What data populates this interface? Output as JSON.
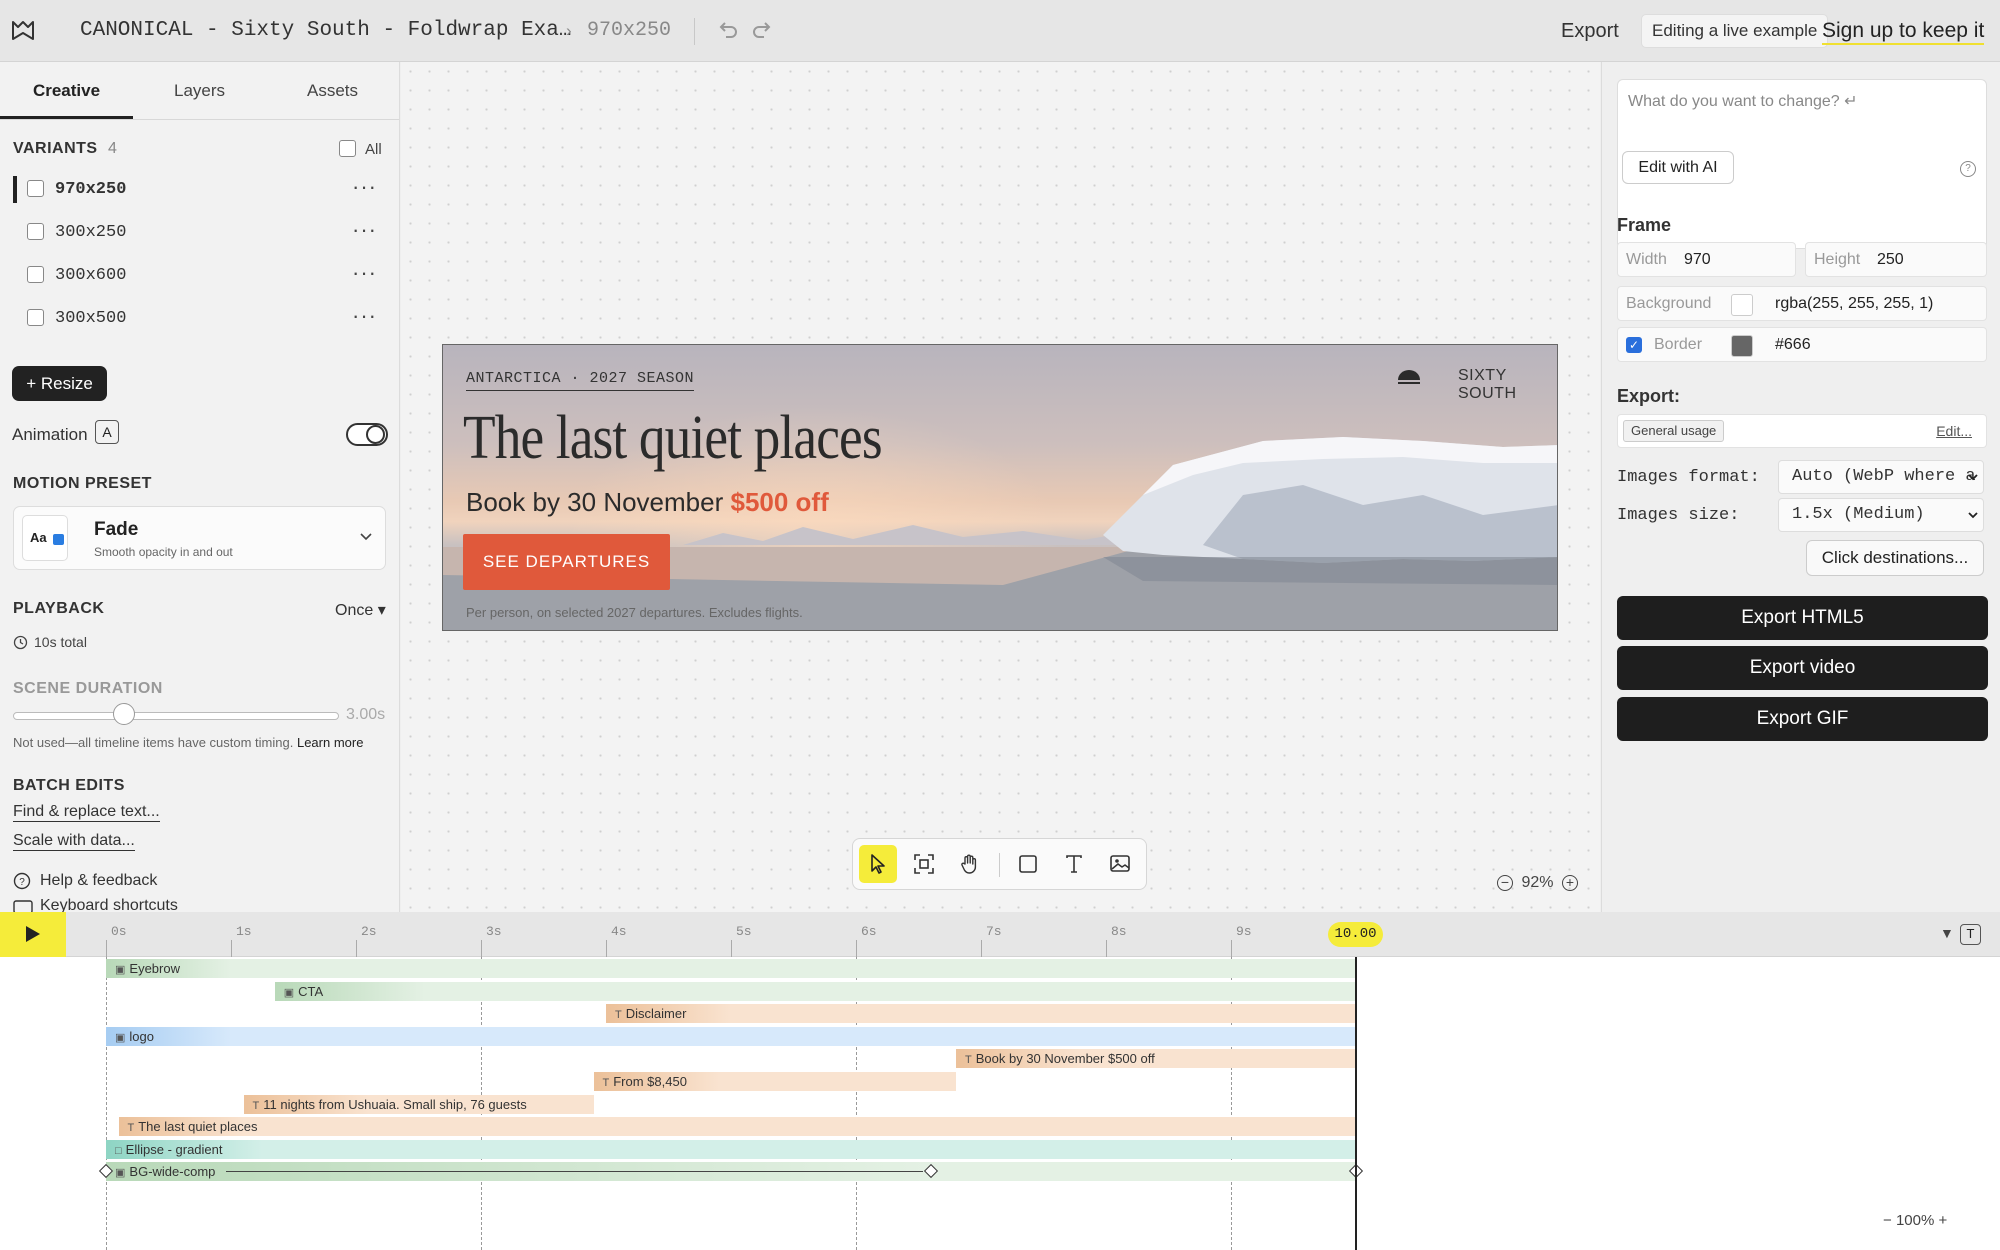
{
  "topbar": {
    "doc_title": "CANONICAL - Sixty South - Foldwrap Exa…",
    "crumb_sep": "›",
    "crumb_size": "970x250",
    "export": "Export",
    "editing_badge": "Editing a live example",
    "signup": "Sign up to keep it"
  },
  "left": {
    "tabs": [
      "Creative",
      "Layers",
      "Assets"
    ],
    "variants_title": "VARIANTS",
    "variants_count": "4",
    "all_label": "All",
    "variants": [
      "970x250",
      "300x250",
      "300x600",
      "300x500"
    ],
    "resize_label": "+ Resize",
    "animation_label": "Animation",
    "animation_key": "A",
    "animation_on": true,
    "motion_preset_title": "MOTION PRESET",
    "preset": {
      "icon_text": "Aa",
      "name": "Fade",
      "desc": "Smooth opacity in and out"
    },
    "playback_title": "PLAYBACK",
    "playback_value": "Once ▾",
    "total": "10s total",
    "scene_title": "SCENE DURATION",
    "scene_value": "3.00s",
    "scene_note": "Not used—all timeline items have custom timing.",
    "learn_more": "Learn more",
    "batch_title": "BATCH EDITS",
    "find_replace": "Find & replace text...",
    "scale_data": "Scale with data...",
    "help": "Help & feedback",
    "shortcuts": "Keyboard shortcuts"
  },
  "banner": {
    "eyebrow": "ANTARCTICA · 2027 SEASON",
    "brand": "SIXTY SOUTH",
    "headline": "The last quiet places",
    "offer_text": "Book by 30 November",
    "offer_price": "$500 off",
    "cta": "SEE DEPARTURES",
    "disclaimer": "Per person, on selected 2027 departures. Excludes flights."
  },
  "canvas": {
    "zoom": "92%"
  },
  "right": {
    "ai_placeholder": "What do you want to change? ↵",
    "ai_button": "Edit with AI",
    "ai_help": "?",
    "frame_title": "Frame",
    "width_label": "Width",
    "width_value": "970",
    "height_label": "Height",
    "height_value": "250",
    "background_label": "Background",
    "background_value": "rgba(255, 255, 255, 1)",
    "border_label": "Border",
    "border_value": "#666",
    "border_checked": true,
    "export_title": "Export:",
    "general_usage": "General usage",
    "edit_link": "Edit...",
    "images_format_label": "Images format:",
    "images_format_value": "Auto (WebP where a",
    "images_size_label": "Images size:",
    "images_size_value": "1.5x (Medium)",
    "click_dest": "Click destinations...",
    "export_html5": "Export HTML5",
    "export_video": "Export video",
    "export_gif": "Export GIF"
  },
  "timeline": {
    "ticks": [
      "0s",
      "1s",
      "2s",
      "3s",
      "4s",
      "5s",
      "6s",
      "7s",
      "8s",
      "9s"
    ],
    "current_time": "10.00",
    "zoom": "100%",
    "t_button": "T",
    "tracks": [
      {
        "name": "Eyebrow",
        "icon": "▣",
        "start": 0,
        "anim_end": 1.0,
        "color": "green"
      },
      {
        "name": "CTA",
        "icon": "▣",
        "start": 1.35,
        "anim_end": 2.55,
        "color": "green"
      },
      {
        "name": "Disclaimer",
        "icon": "T",
        "start": 4.0,
        "anim_end": 5.0,
        "color": "orange"
      },
      {
        "name": "logo",
        "icon": "▣",
        "start": 0,
        "anim_end": 1.0,
        "color": "blue"
      },
      {
        "name": "Book by 30 November $500 off",
        "icon": "T",
        "start": 6.8,
        "anim_end": 7.8,
        "color": "orange"
      },
      {
        "name": "From $8,450",
        "icon": "T",
        "start": 3.9,
        "anim_end": 4.9,
        "end": 6.8,
        "color": "orange"
      },
      {
        "name": "11 nights from Ushuaia. Small ship, 76 guests",
        "icon": "T",
        "start": 1.1,
        "anim_end": 2.1,
        "end": 3.9,
        "color": "orange"
      },
      {
        "name": "The last quiet places",
        "icon": "T",
        "start": 0.1,
        "anim_end": 1.1,
        "color": "orange"
      },
      {
        "name": "Ellipse - gradient",
        "icon": "□",
        "start": 0,
        "anim_end": 1.25,
        "color": "teal"
      },
      {
        "name": "BG-wide-comp",
        "icon": "▣",
        "start": 0,
        "anim_end": 6.6,
        "color": "green"
      }
    ],
    "total_seconds": 10
  },
  "colors": {
    "accent_yellow": "#f5ec3a",
    "brand_orange": "#e0593b",
    "dark": "#1e1e1e"
  }
}
